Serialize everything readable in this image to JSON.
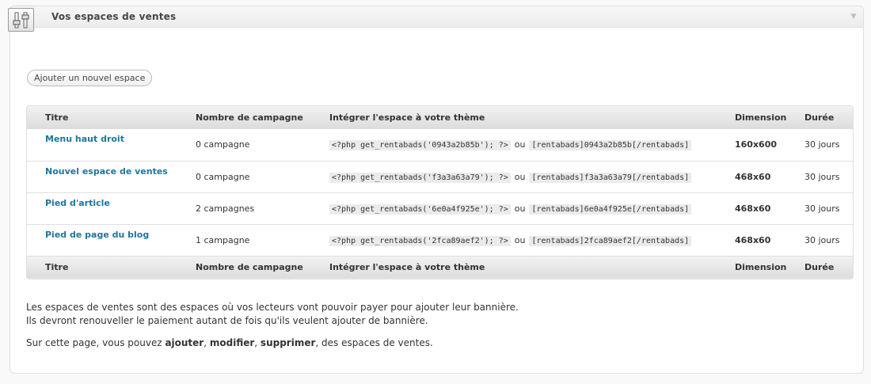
{
  "widget": {
    "title": "Vos espaces de ventes",
    "toggle_icon": "triangle-down-icon",
    "header_icon": "sliders-icon"
  },
  "add_button_label": "Ajouter un nouvel espace",
  "table": {
    "headers": [
      "Titre",
      "Nombre de campagne",
      "Intégrer l'espace à votre thème",
      "Dimension",
      "Durée"
    ],
    "rows": [
      {
        "title": "Menu haut droit",
        "count": "0 campagne",
        "php": "<?php get_rentabads('0943a2b85b'); ?>",
        "ou": "ou",
        "shortcode": "[rentabads]0943a2b85b[/rentabads]",
        "dimension": "160x600",
        "duration": "30 jours"
      },
      {
        "title": "Nouvel espace de ventes",
        "count": "0 campagne",
        "php": "<?php get_rentabads('f3a3a63a79'); ?>",
        "ou": "ou",
        "shortcode": "[rentabads]f3a3a63a79[/rentabads]",
        "dimension": "468x60",
        "duration": "30 jours"
      },
      {
        "title": "Pied d'article",
        "count": "2 campagnes",
        "php": "<?php get_rentabads('6e0a4f925e'); ?>",
        "ou": "ou",
        "shortcode": "[rentabads]6e0a4f925e[/rentabads]",
        "dimension": "468x60",
        "duration": "30 jours"
      },
      {
        "title": "Pied de page du blog",
        "count": "1 campagne",
        "php": "<?php get_rentabads('2fca89aef2'); ?>",
        "ou": "ou",
        "shortcode": "[rentabads]2fca89aef2[/rentabads]",
        "dimension": "468x60",
        "duration": "30 jours"
      }
    ]
  },
  "info": {
    "line1": "Les espaces de ventes sont des espaces où vos lecteurs vont pouvoir payer pour ajouter leur bannière.",
    "line2": "Ils devront renouveller le paiement autant de fois qu'ils veulent ajouter de bannière.",
    "line3_prefix": "Sur cette page, vous pouvez ",
    "line3_add": "ajouter",
    "line3_sep1": ", ",
    "line3_edit": "modifier",
    "line3_sep2": ", ",
    "line3_delete": "supprimer",
    "line3_suffix": ", des espaces de ventes."
  }
}
